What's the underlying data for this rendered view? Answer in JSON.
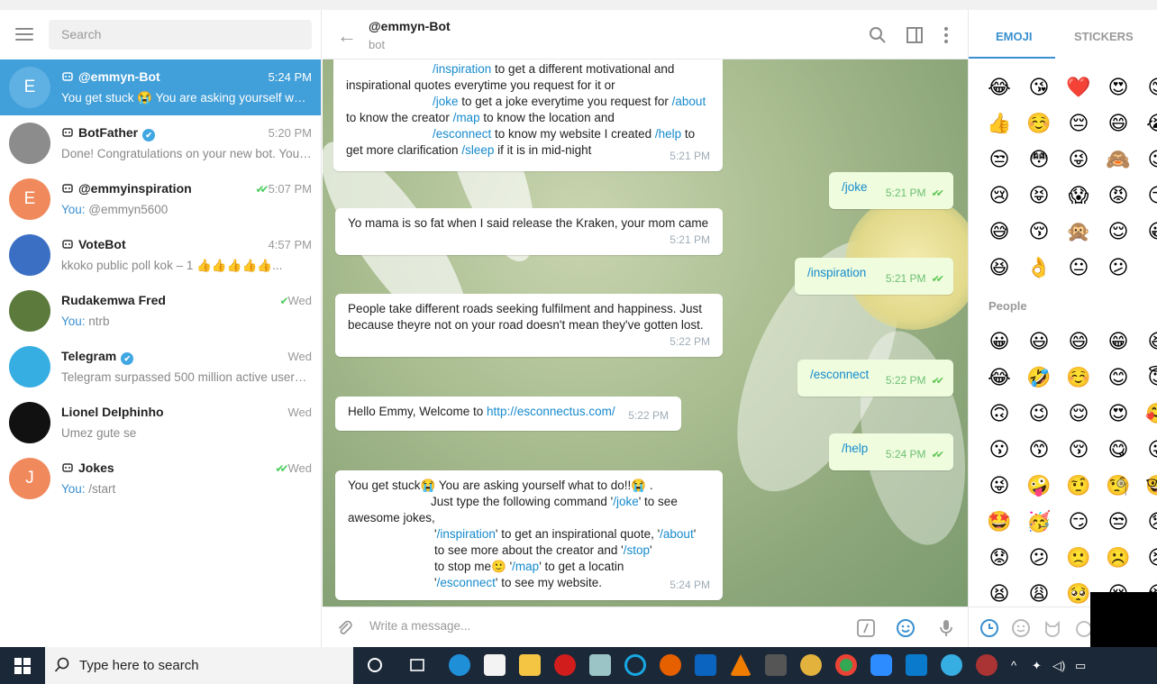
{
  "left": {
    "search_placeholder": "Search",
    "chats": [
      {
        "initial": "E",
        "name": "@emmyn-Bot",
        "time": "5:24 PM",
        "preview": "You get stuck 😭 You are asking yourself wha...",
        "prefix": "",
        "avatar_color": "#e3704e"
      },
      {
        "initial": "",
        "name": "BotFather",
        "time": "5:20 PM",
        "preview": "Done! Congratulations on your new bot. You ...",
        "prefix": "",
        "avatar_color": "#8c8c8c"
      },
      {
        "initial": "E",
        "name": "@emmyinspiration",
        "time": "5:07 PM",
        "preview": "@emmyn5600",
        "prefix": "You: ",
        "avatar_color": "#f08a5d"
      },
      {
        "initial": "",
        "name": "VoteBot",
        "time": "4:57 PM",
        "preview": "kkoko public poll  kok – 1 👍👍👍👍👍...",
        "prefix": "",
        "avatar_color": "#3b6fc4"
      },
      {
        "initial": "",
        "name": "Rudakemwa Fred",
        "time": "Wed",
        "preview": "ntrb",
        "prefix": "You: ",
        "avatar_color": "#5b7a3c"
      },
      {
        "initial": "",
        "name": "Telegram",
        "time": "Wed",
        "preview": "Telegram surpassed 500 million active users. ...",
        "prefix": "",
        "avatar_color": "#37aee2"
      },
      {
        "initial": "",
        "name": "Lionel Delphinho",
        "time": "Wed",
        "preview": "Umez gute se",
        "prefix": "",
        "avatar_color": "#111111"
      },
      {
        "initial": "J",
        "name": "Jokes",
        "time": "Wed",
        "preview": "/start",
        "prefix": "You: ",
        "avatar_color": "#f08a5d"
      }
    ]
  },
  "header": {
    "title": "@emmyn-Bot",
    "subtitle": "bot"
  },
  "messages": {
    "m1_l1": "/inspiration",
    "m1_l1b": " to get a different motivational and",
    "m1_l2": "inspirational quotes everytime you request for it or",
    "m1_l3a": "/joke",
    "m1_l3b": " to get a joke everytime you request for ",
    "m1_l3c": "/about",
    "m1_l4a": "to know the creator ",
    "m1_l4b": "/map",
    "m1_l4c": " to know the location and",
    "m1_l5a": "/esconnect",
    "m1_l5b": " to know my website I created ",
    "m1_l5c": "/help",
    "m1_l5d": " to",
    "m1_l6a": "get more clarification ",
    "m1_l6b": "/sleep",
    "m1_l6c": " if it is in mid-night",
    "m1_time": "5:21 PM",
    "o1": "/joke",
    "o1_time": "5:21 PM",
    "m2": "Yo mama is so fat when I said release the Kraken, your mom came",
    "m2_time": "5:21 PM",
    "o2": "/inspiration",
    "o2_time": "5:21 PM",
    "m3_l1": "People take different roads seeking fulfilment and happiness. Just",
    "m3_l2": "because theyre not on your road doesn't mean they've gotten lost.",
    "m3_time": "5:22 PM",
    "o3": "/esconnect",
    "o3_time": "5:22 PM",
    "m4a": "Hello Emmy, Welcome to ",
    "m4b": "http://esconnectus.com/",
    "m4_time": "5:22 PM",
    "o4": "/help",
    "o4_time": "5:24 PM",
    "m5_l1": "You get stuck😭 You are asking yourself what to do!!😭 .",
    "m5_l2a": "Just type the following command  '",
    "m5_l2b": "/joke",
    "m5_l2c": "' to see",
    "m5_l3": "awesome jokes,",
    "m5_l4a": "'",
    "m5_l4b": "/inspiration",
    "m5_l4c": "' to get  an inspirational quote, '",
    "m5_l4d": "/about",
    "m5_l4e": "'",
    "m5_l5a": " to see more about the creator and '",
    "m5_l5b": "/stop",
    "m5_l5c": "'",
    "m5_l6a": " to stop me🙂 '",
    "m5_l6b": "/map",
    "m5_l6c": "' to get a locatin",
    "m5_l7a": "'",
    "m5_l7b": "/esconnect",
    "m5_l7c": "' to see my website.",
    "m5_time": "5:24 PM"
  },
  "composer": {
    "placeholder": "Write a message..."
  },
  "emoji_panel": {
    "tab_emoji": "EMOJI",
    "tab_stickers": "STICKERS",
    "section_people": "People",
    "recent_rows": [
      [
        "😂",
        "😘",
        "❤️",
        "😍",
        "😊"
      ],
      [
        "👍",
        "☺️",
        "😔",
        "😄",
        "😭"
      ],
      [
        "😒",
        "😳",
        "😜",
        "🙈",
        "😉"
      ],
      [
        "😢",
        "😝",
        "😱",
        "😡",
        "😏"
      ],
      [
        "😅",
        "😚",
        "🙊",
        "😌",
        "😀"
      ],
      [
        "😆",
        "👌",
        "😐",
        "😕"
      ]
    ],
    "people_rows": [
      [
        "😀",
        "😃",
        "😄",
        "😁",
        "😆"
      ],
      [
        "😂",
        "🤣",
        "☺️",
        "😊",
        "😇"
      ],
      [
        "🙃",
        "😉",
        "😌",
        "😍",
        "🥰"
      ],
      [
        "😗",
        "😙",
        "😚",
        "😋",
        "😛"
      ],
      [
        "😜",
        "🤪",
        "🤨",
        "🧐",
        "🤓"
      ],
      [
        "🤩",
        "🥳",
        "😏",
        "😒",
        "😞"
      ],
      [
        "😟",
        "😕",
        "🙁",
        "☹️",
        "😣"
      ],
      [
        "😫",
        "😩",
        "🥺",
        "😢",
        "😭"
      ]
    ]
  },
  "taskbar": {
    "search_text": "Type here to search"
  }
}
